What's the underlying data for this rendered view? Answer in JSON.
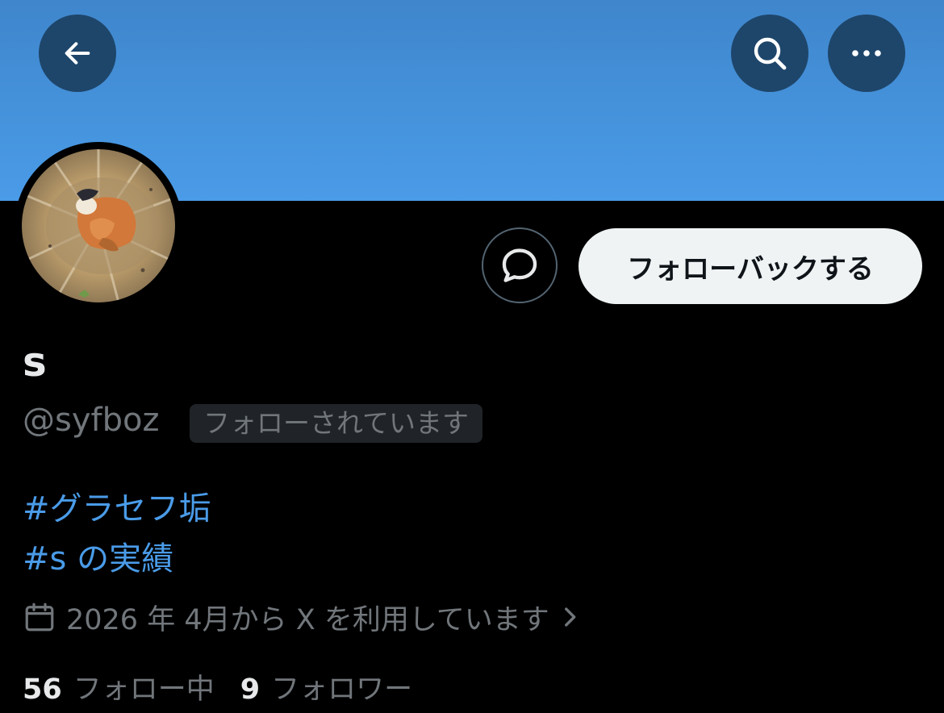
{
  "header": {
    "back_icon": "arrow-left-icon",
    "search_icon": "search-icon",
    "more_icon": "more-horizontal-icon"
  },
  "profile": {
    "display_name": "s",
    "handle": "@syfboz",
    "follows_you_badge": "フォローされています",
    "bio_tags": [
      "#グラセフ垢",
      "#s の実績"
    ],
    "joined_text": "2026 年 4月から X を利用しています",
    "following_count": "56",
    "following_label": "フォロー中",
    "followers_count": "9",
    "followers_label": "フォロワー"
  },
  "actions": {
    "message_icon": "message-bubble-icon",
    "follow_back_label": "フォローバックする"
  },
  "colors": {
    "banner": "#4592db",
    "accent_link": "#4a9be8",
    "muted_text": "#71767b",
    "header_button_bg": "#1e466b"
  }
}
